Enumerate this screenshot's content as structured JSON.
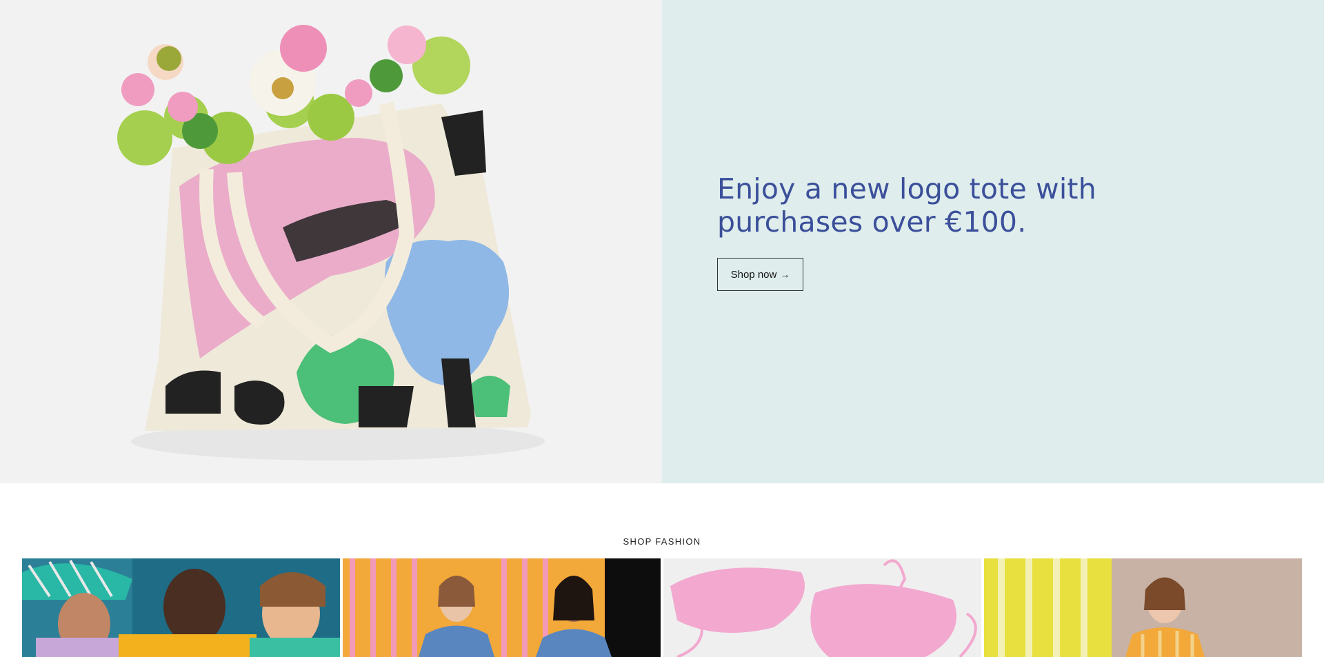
{
  "hero": {
    "image_alt": "Logo tote bag with flowers",
    "heading": "Enjoy a new logo tote with purchases over €100.",
    "cta_label": "Shop now",
    "cta_arrow": "→",
    "colors": {
      "panel_bg": "#dfeeed",
      "heading": "#3b4f9a",
      "image_bg": "#f2f2f2"
    }
  },
  "fashion": {
    "title": "SHOP FASHION",
    "tiles": [
      {
        "alt": "People in striped shirts and bucket hat"
      },
      {
        "alt": "Models in denim shirts on striped background"
      },
      {
        "alt": "Pink leather bags"
      },
      {
        "alt": "Model in striped top beside yellow stripes"
      }
    ]
  }
}
